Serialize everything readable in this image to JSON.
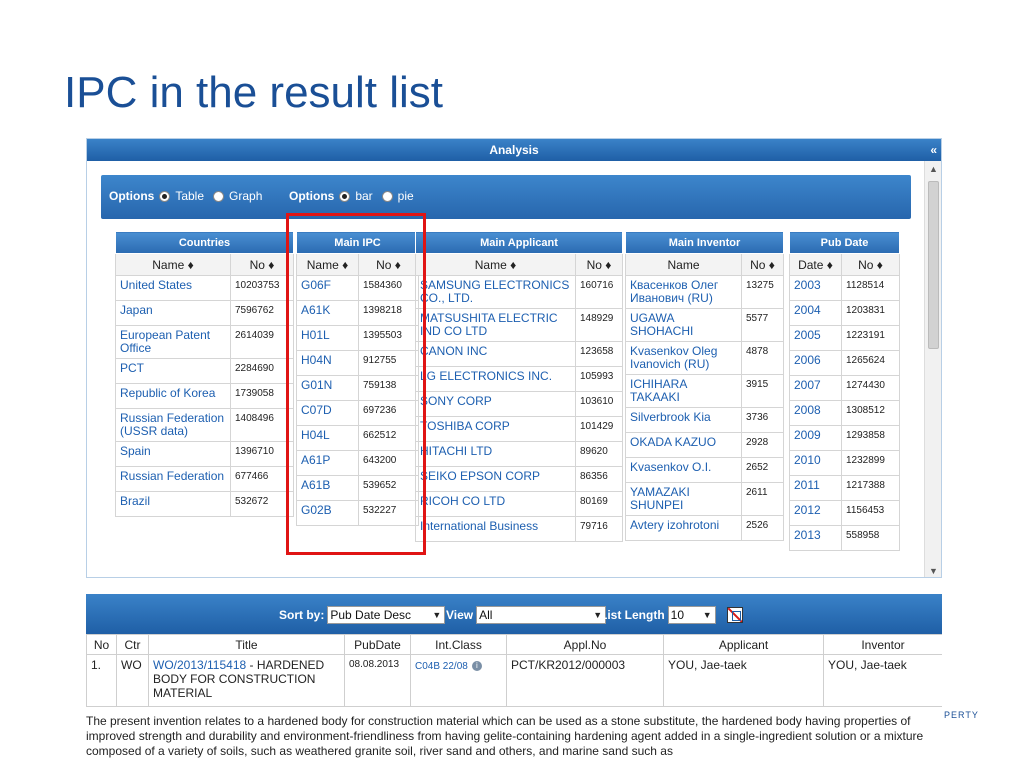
{
  "slide": {
    "title": "IPC in the result list",
    "footer_fragment": "PERTY"
  },
  "analysis": {
    "title": "Analysis",
    "collapse_glyph": "«",
    "options": [
      {
        "label": "Options",
        "choices": [
          {
            "label": "Table",
            "selected": true
          },
          {
            "label": "Graph",
            "selected": false
          }
        ]
      },
      {
        "label": "Options",
        "choices": [
          {
            "label": "bar",
            "selected": true
          },
          {
            "label": "pie",
            "selected": false
          }
        ]
      }
    ],
    "countries": {
      "header": "Countries",
      "cols": [
        "Name ♦",
        "No ♦"
      ],
      "rows": [
        [
          "United States",
          "10203753"
        ],
        [
          "Japan",
          "7596762"
        ],
        [
          "European Patent Office",
          "2614039"
        ],
        [
          "PCT",
          "2284690"
        ],
        [
          "Republic of Korea",
          "1739058"
        ],
        [
          "Russian Federation (USSR data)",
          "1408496"
        ],
        [
          "Spain",
          "1396710"
        ],
        [
          "Russian Federation",
          "677466"
        ],
        [
          "Brazil",
          "532672"
        ]
      ]
    },
    "ipc": {
      "header": "Main IPC",
      "cols": [
        "Name ♦",
        "No ♦"
      ],
      "rows": [
        [
          "G06F",
          "1584360"
        ],
        [
          "A61K",
          "1398218"
        ],
        [
          "H01L",
          "1395503"
        ],
        [
          "H04N",
          "912755"
        ],
        [
          "G01N",
          "759138"
        ],
        [
          "C07D",
          "697236"
        ],
        [
          "H04L",
          "662512"
        ],
        [
          "A61P",
          "643200"
        ],
        [
          "A61B",
          "539652"
        ],
        [
          "G02B",
          "532227"
        ]
      ]
    },
    "applicant": {
      "header": "Main Applicant",
      "cols": [
        "Name ♦",
        "No ♦"
      ],
      "rows": [
        [
          "SAMSUNG ELECTRONICS CO., LTD.",
          "160716"
        ],
        [
          "MATSUSHITA ELECTRIC IND CO LTD",
          "148929"
        ],
        [
          "CANON INC",
          "123658"
        ],
        [
          "LG ELECTRONICS INC.",
          "105993"
        ],
        [
          "SONY CORP",
          "103610"
        ],
        [
          "TOSHIBA CORP",
          "101429"
        ],
        [
          "HITACHI LTD",
          "89620"
        ],
        [
          "SEIKO EPSON CORP",
          "86356"
        ],
        [
          "RICOH CO LTD",
          "80169"
        ],
        [
          "International Business",
          "79716"
        ]
      ]
    },
    "inventor": {
      "header": "Main Inventor",
      "cols": [
        "Name",
        "No ♦"
      ],
      "rows": [
        [
          "Квасенков Олег Иванович (RU)",
          "13275"
        ],
        [
          "UGAWA SHOHACHI",
          "5577"
        ],
        [
          "Kvasenkov Oleg Ivanovich (RU)",
          "4878"
        ],
        [
          "ICHIHARA TAKAAKI",
          "3915"
        ],
        [
          "Silverbrook Kia",
          "3736"
        ],
        [
          "OKADA KAZUO",
          "2928"
        ],
        [
          "Kvasenkov O.I.",
          "2652"
        ],
        [
          "YAMAZAKI SHUNPEI",
          "2611"
        ],
        [
          "Avtery izohrotoni",
          "2526"
        ]
      ]
    },
    "pubdate": {
      "header": "Pub Date",
      "cols": [
        "Date ♦",
        "No ♦"
      ],
      "rows": [
        [
          "2003",
          "1128514"
        ],
        [
          "2004",
          "1203831"
        ],
        [
          "2005",
          "1223191"
        ],
        [
          "2006",
          "1265624"
        ],
        [
          "2007",
          "1274430"
        ],
        [
          "2008",
          "1308512"
        ],
        [
          "2009",
          "1293858"
        ],
        [
          "2010",
          "1232899"
        ],
        [
          "2011",
          "1217388"
        ],
        [
          "2012",
          "1156453"
        ],
        [
          "2013",
          "558958"
        ]
      ]
    }
  },
  "results": {
    "sort_label": "Sort by:",
    "sort_value": "Pub Date Desc",
    "view_label": "View",
    "view_value": "All",
    "length_label": "List Length",
    "length_value": "10",
    "columns": [
      "No",
      "Ctr",
      "Title",
      "PubDate",
      "Int.Class",
      "Appl.No",
      "Applicant",
      "Inventor"
    ],
    "row": {
      "no": "1.",
      "ctr": "WO",
      "title_link": "WO/2013/115418",
      "title_text": " - HARDENED BODY FOR CONSTRUCTION MATERIAL",
      "pubdate": "08.08.2013",
      "intclass": "C04B 22/08",
      "applno": "PCT/KR2012/000003",
      "applicant": "YOU, Jae-taek",
      "inventor": "YOU, Jae-taek"
    },
    "abstract": "The present invention relates to a hardened body for construction material which can be used as a stone substitute, the hardened body having properties of improved strength and durability and environment-friendliness from having gelite-containing hardening agent added in a single-ingredient solution or a mixture composed of a variety of soils, such as weathered granite soil, river sand and others, and marine sand such as"
  }
}
